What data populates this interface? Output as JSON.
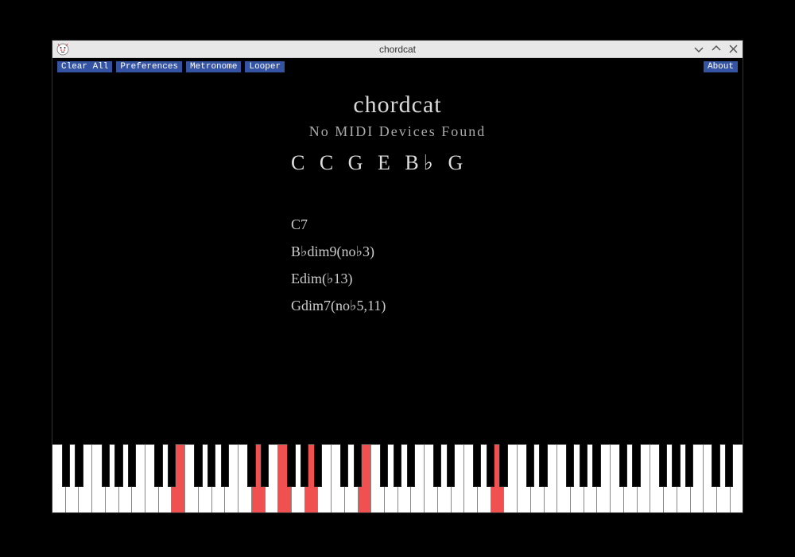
{
  "window": {
    "title": "chordcat"
  },
  "toolbar": {
    "clear_all": "Clear All",
    "preferences": "Preferences",
    "metronome": "Metronome",
    "looper": "Looper",
    "about": "About"
  },
  "main": {
    "app_title": "chordcat",
    "status": "No MIDI Devices Found",
    "notes_display": "C  C  G  E  B♭ G",
    "chords": [
      "C7",
      "B♭dim9(no♭3)",
      "Edim(♭13)",
      "Gdim7(no♭5,11)"
    ]
  },
  "piano": {
    "white_key_count": 52,
    "octaves": 7,
    "white_semitone_offsets": [
      0,
      2,
      4,
      5,
      7,
      9,
      11
    ],
    "black_after_white_indices": [
      0,
      1,
      3,
      4,
      5
    ],
    "pressed_white_indices": [
      9,
      15,
      17,
      19,
      23,
      33
    ],
    "pressed_black": [
      {
        "after_white": 20
      }
    ]
  },
  "colors": {
    "pressed": "#f05050",
    "toolbar_button_bg": "#3454a3"
  }
}
